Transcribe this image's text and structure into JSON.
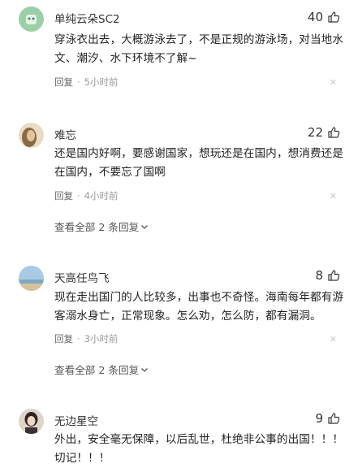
{
  "comments": [
    {
      "username": "单纯云朵SC2",
      "likes": "40",
      "text": "穿泳衣出去，大概游泳去了，不是正规的游泳场，对当地水文、潮汐、水下环境不了解~",
      "reply_label": "回复",
      "separator": "·",
      "time": "5小时前",
      "avatar_colors": {
        "bg": "#9ccfa8",
        "fg": "#3d8b57"
      }
    },
    {
      "username": "难忘",
      "likes": "22",
      "text": "还是国内好啊，要感谢国家，想玩还是在国内，想消费还是在国内，不要忘了国啊",
      "reply_label": "回复",
      "separator": "·",
      "time": "4小时前",
      "view_all": "查看全部 2 条回复",
      "avatar_colors": {
        "bg": "#c9a77a",
        "fg": "#6b4a2a"
      }
    },
    {
      "username": "天高任鸟飞",
      "likes": "8",
      "text": "现在走出国门的人比较多，出事也不奇怪。海南每年都有游客溺水身亡，正常现象。怎么劝，怎么防，都有漏洞。",
      "reply_label": "回复",
      "separator": "·",
      "time": "3小时前",
      "view_all": "查看全部 2 条回复",
      "avatar_colors": {
        "bg": "#9fc3dd",
        "fg": "#c8b28a"
      }
    },
    {
      "username": "无边星空",
      "likes": "9",
      "text": "外出，安全毫无保障，以后乱世，杜绝非公事的出国！！！切记！！！",
      "avatar_colors": {
        "bg": "#d9d2c8",
        "fg": "#3a3030"
      }
    }
  ],
  "colors": {
    "text": "#222222",
    "meta": "#999999",
    "close": "#c8c8c8"
  },
  "icons": {
    "like": "thumb-up-icon",
    "close": "close-icon",
    "expand": "chevron-down-icon"
  }
}
